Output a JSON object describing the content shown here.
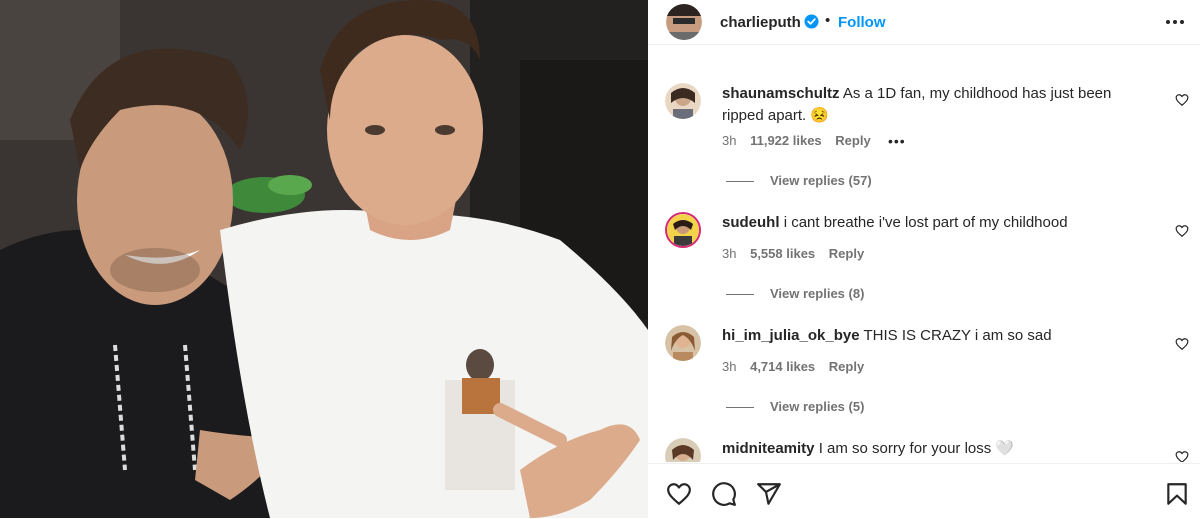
{
  "post": {
    "username": "charlieputh",
    "dot": "•",
    "follow_label": "Follow",
    "verified": true,
    "avatar_icon": "avatar-charlieputh"
  },
  "comments": [
    {
      "username": "shaunamschultz",
      "text": "As a 1D fan, my childhood has just been ripped apart. 😣",
      "time": "3h",
      "likes": "11,922 likes",
      "reply_label": "Reply",
      "more": "•••",
      "view_replies": "View replies (57)"
    },
    {
      "username": "sudeuhl",
      "text": "i cant breathe i've lost part of my childhood",
      "time": "3h",
      "likes": "5,558 likes",
      "reply_label": "Reply",
      "view_replies": "View replies (8)"
    },
    {
      "username": "hi_im_julia_ok_bye",
      "text": "THIS IS CRAZY i am so sad",
      "time": "3h",
      "likes": "4,714 likes",
      "reply_label": "Reply",
      "view_replies": "View replies (5)"
    },
    {
      "username": "midniteamity",
      "text": "I am so sorry for your loss 🤍"
    }
  ],
  "actions": {
    "icons": [
      "heart-icon",
      "comment-icon",
      "share-icon",
      "bookmark-icon"
    ]
  },
  "colors": {
    "follow": "#0095f6",
    "verified": "#0095f6",
    "meta": "#737373"
  }
}
